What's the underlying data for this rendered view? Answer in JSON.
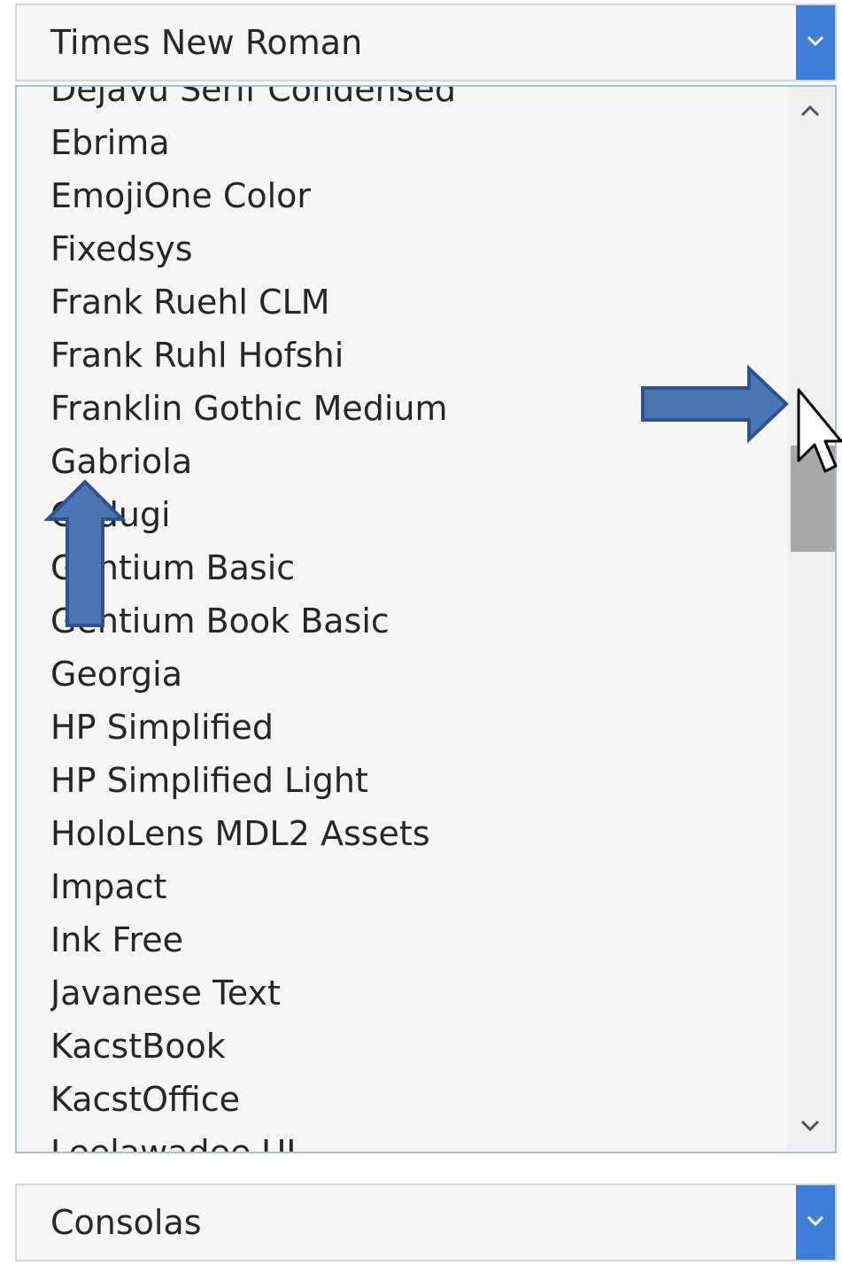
{
  "font_select": {
    "value": "Times New Roman"
  },
  "font_list": {
    "items": [
      "DejaVu Serif Condensed",
      "Ebrima",
      "EmojiOne Color",
      "Fixedsys",
      "Frank Ruehl CLM",
      "Frank Ruhl Hofshi",
      "Franklin Gothic Medium",
      "Gabriola",
      "Gadugi",
      "Gentium Basic",
      "Gentium Book Basic",
      "Georgia",
      "HP Simplified",
      "HP Simplified Light",
      "HoloLens MDL2 Assets",
      "Impact",
      "Ink Free",
      "Javanese Text",
      "KacstBook",
      "KacstOffice",
      "Leelawadee UI"
    ],
    "scroll_position": 0.36
  },
  "secondary_select": {
    "value": "Consolas"
  },
  "icons": {
    "dropdown": "chevron-down-icon",
    "scroll_up": "chevron-up-icon",
    "scroll_down": "chevron-down-icon",
    "annotation_right": "arrow-right-icon",
    "annotation_up": "arrow-up-icon",
    "pointer": "mouse-pointer-icon"
  },
  "colors": {
    "accent": "#3d7fd8",
    "annotation_fill": "#4a77b4",
    "annotation_stroke": "#2f528f",
    "scroll_thumb": "#a8a8a8"
  }
}
